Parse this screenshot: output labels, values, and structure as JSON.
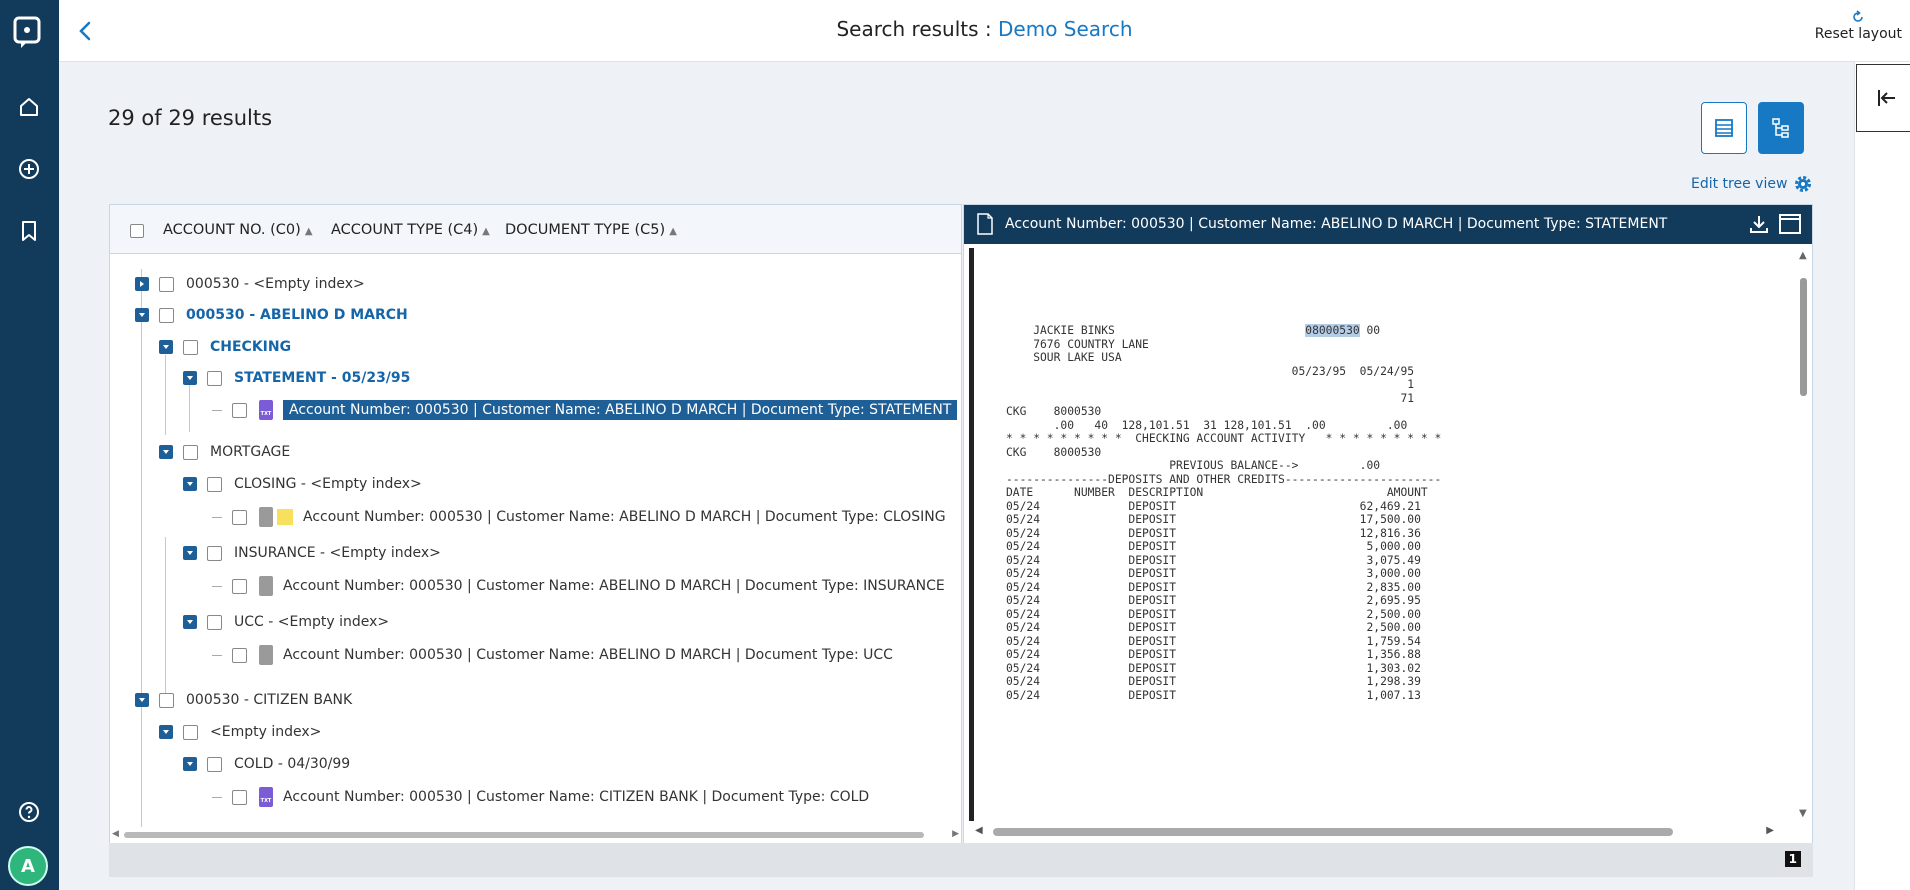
{
  "nav": {
    "items": [
      {
        "icon": "logo-icon"
      },
      {
        "icon": "home-icon"
      },
      {
        "icon": "add-circle-icon"
      },
      {
        "icon": "bookmark-icon"
      },
      {
        "icon": "help-icon"
      }
    ],
    "avatar": "A"
  },
  "header": {
    "title_prefix": "Search results : ",
    "title_link": "Demo Search",
    "reset_label": "Reset layout"
  },
  "results": {
    "count": "29 of 29 results",
    "edit_tree": "Edit tree view"
  },
  "tree": {
    "columns": [
      "ACCOUNT NO. (C0)",
      "ACCOUNT TYPE (C4)",
      "DOCUMENT TYPE (C5)"
    ],
    "rows": [
      {
        "label": "000530 - <Empty index>"
      },
      {
        "label": "000530 - ABELINO D MARCH"
      },
      {
        "label": "CHECKING"
      },
      {
        "label": "STATEMENT - 05/23/95"
      },
      {
        "label": "Account Number: 000530 | Customer Name: ABELINO D MARCH | Document Type: STATEMENT"
      },
      {
        "label": "MORTGAGE"
      },
      {
        "label": "CLOSING - <Empty index>"
      },
      {
        "label": "Account Number: 000530 | Customer Name: ABELINO D MARCH | Document Type: CLOSING"
      },
      {
        "label": "INSURANCE - <Empty index>"
      },
      {
        "label": "Account Number: 000530 | Customer Name: ABELINO D MARCH | Document Type: INSURANCE"
      },
      {
        "label": "UCC - <Empty index>"
      },
      {
        "label": "Account Number: 000530 | Customer Name: ABELINO D MARCH | Document Type: UCC"
      },
      {
        "label": "000530 - CITIZEN BANK"
      },
      {
        "label": "<Empty index>"
      },
      {
        "label": "COLD - 04/30/99"
      },
      {
        "label": "Account Number: 000530 | Customer Name: CITIZEN BANK | Document Type: COLD"
      }
    ]
  },
  "viewer": {
    "title": "Account Number: 000530 | Customer Name: ABELINO D MARCH | Document Type: STATEMENT",
    "doc": {
      "name": "JACKIE BINKS",
      "addr1": "7676 COUNTRY LANE",
      "addr2": "SOUR LAKE USA",
      "acct_hl": "08000530",
      "acct_rest": " 00",
      "dates": "05/23/95  05/24/95",
      "n1": "1",
      "n2": "71",
      "ckg1": "CKG    8000530",
      "summary": "       .00   40  128,101.51  31 128,101.51  .00         .00",
      "activity": "* * * * * * * * *  CHECKING ACCOUNT ACTIVITY   * * * * * * * * *",
      "ckg2": "CKG    8000530",
      "prev": "                        PREVIOUS BALANCE-->         .00",
      "sep": "---------------DEPOSITS AND OTHER CREDITS-----------------------",
      "cols": "DATE      NUMBER  DESCRIPTION                           AMOUNT",
      "lines": [
        "05/24             DEPOSIT                           62,469.21",
        "05/24             DEPOSIT                           17,500.00",
        "05/24             DEPOSIT                           12,816.36",
        "05/24             DEPOSIT                            5,000.00",
        "05/24             DEPOSIT                            3,075.49",
        "05/24             DEPOSIT                            3,000.00",
        "05/24             DEPOSIT                            2,835.00",
        "05/24             DEPOSIT                            2,695.95",
        "05/24             DEPOSIT                            2,500.00",
        "05/24             DEPOSIT                            2,500.00",
        "05/24             DEPOSIT                            1,759.54",
        "05/24             DEPOSIT                            1,356.88",
        "05/24             DEPOSIT                            1,303.02",
        "05/24             DEPOSIT                            1,298.39",
        "05/24             DEPOSIT                            1,007.13"
      ]
    }
  },
  "footer": {
    "page": "1"
  },
  "colors": {
    "nav": "#123a5b",
    "accent": "#1778c4",
    "selected": "#1d5f96"
  }
}
